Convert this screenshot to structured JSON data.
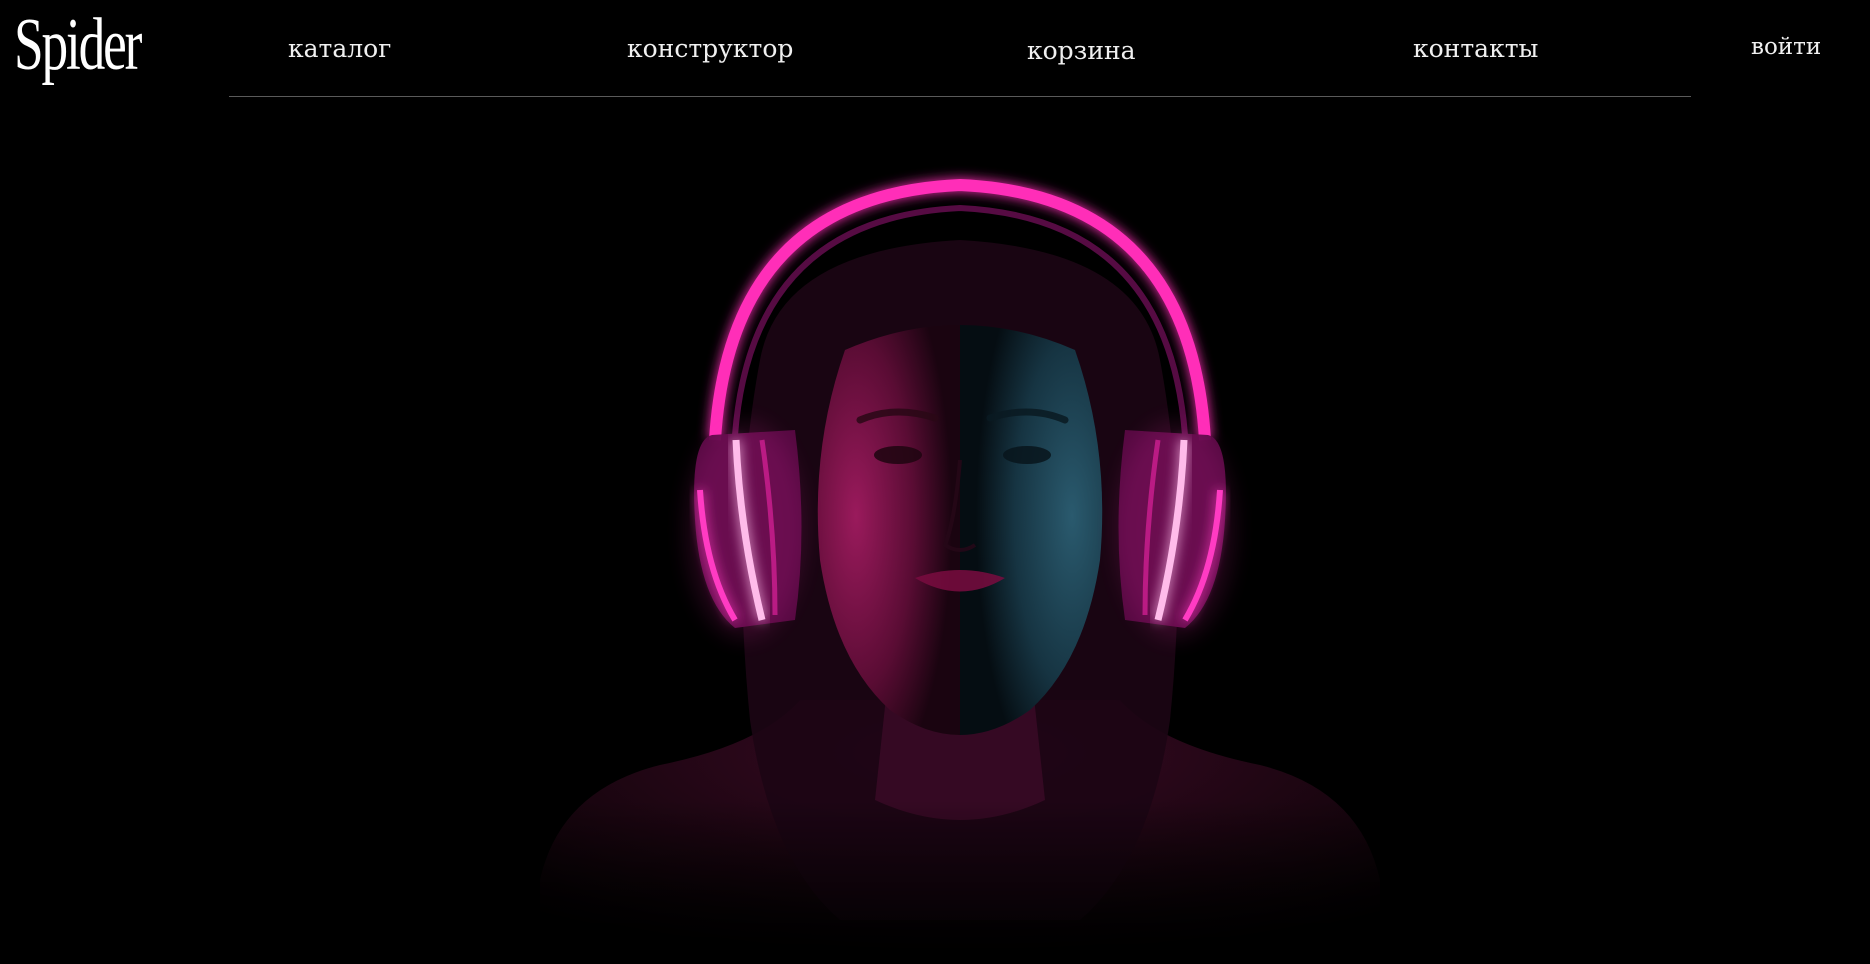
{
  "brand": {
    "logo_text": "Spider"
  },
  "nav": {
    "items": [
      {
        "label": "каталог"
      },
      {
        "label": "конструктор"
      },
      {
        "label": "корзина"
      },
      {
        "label": "контакты"
      }
    ],
    "login_label": "войти"
  },
  "hero": {
    "image_subject": "woman-with-neon-headphones-photo",
    "colors": {
      "background": "#000000",
      "neon_pink": "#ff2fb8",
      "skin_magenta": "#8a1450",
      "skin_teal": "#1e4a5a"
    }
  }
}
